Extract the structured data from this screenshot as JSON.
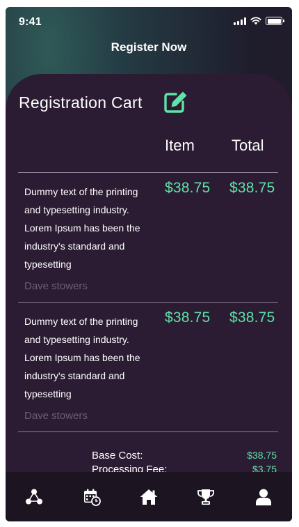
{
  "status_bar": {
    "time": "9:41"
  },
  "header": {
    "title": "Register Now"
  },
  "cart": {
    "title": "Registration Cart",
    "columns": {
      "item": "Item",
      "total": "Total"
    },
    "lines": [
      {
        "description": "Dummy text of the printing and typesetting industry. Lorem Ipsum has been the industry's standard and typesetting",
        "name": "Dave stowers",
        "item_price": "$38.75",
        "total_price": "$38.75"
      },
      {
        "description": "Dummy text of the printing and typesetting industry. Lorem Ipsum has been the industry's standard and typesetting",
        "name": "Dave stowers",
        "item_price": "$38.75",
        "total_price": "$38.75"
      }
    ],
    "summary": [
      {
        "label": "Base Cost:",
        "value": "$38.75"
      },
      {
        "label": "Processing Fee:",
        "value": "$3.75"
      }
    ]
  },
  "nav": {
    "items": [
      {
        "icon": "network-icon"
      },
      {
        "icon": "calendar-icon"
      },
      {
        "icon": "home-icon"
      },
      {
        "icon": "trophy-icon"
      },
      {
        "icon": "profile-icon"
      }
    ]
  },
  "colors": {
    "accent": "#5ee3a8",
    "card_bg": "#2c1c33",
    "nav_bg": "#1c1521",
    "muted_text": "#6b5d72"
  }
}
